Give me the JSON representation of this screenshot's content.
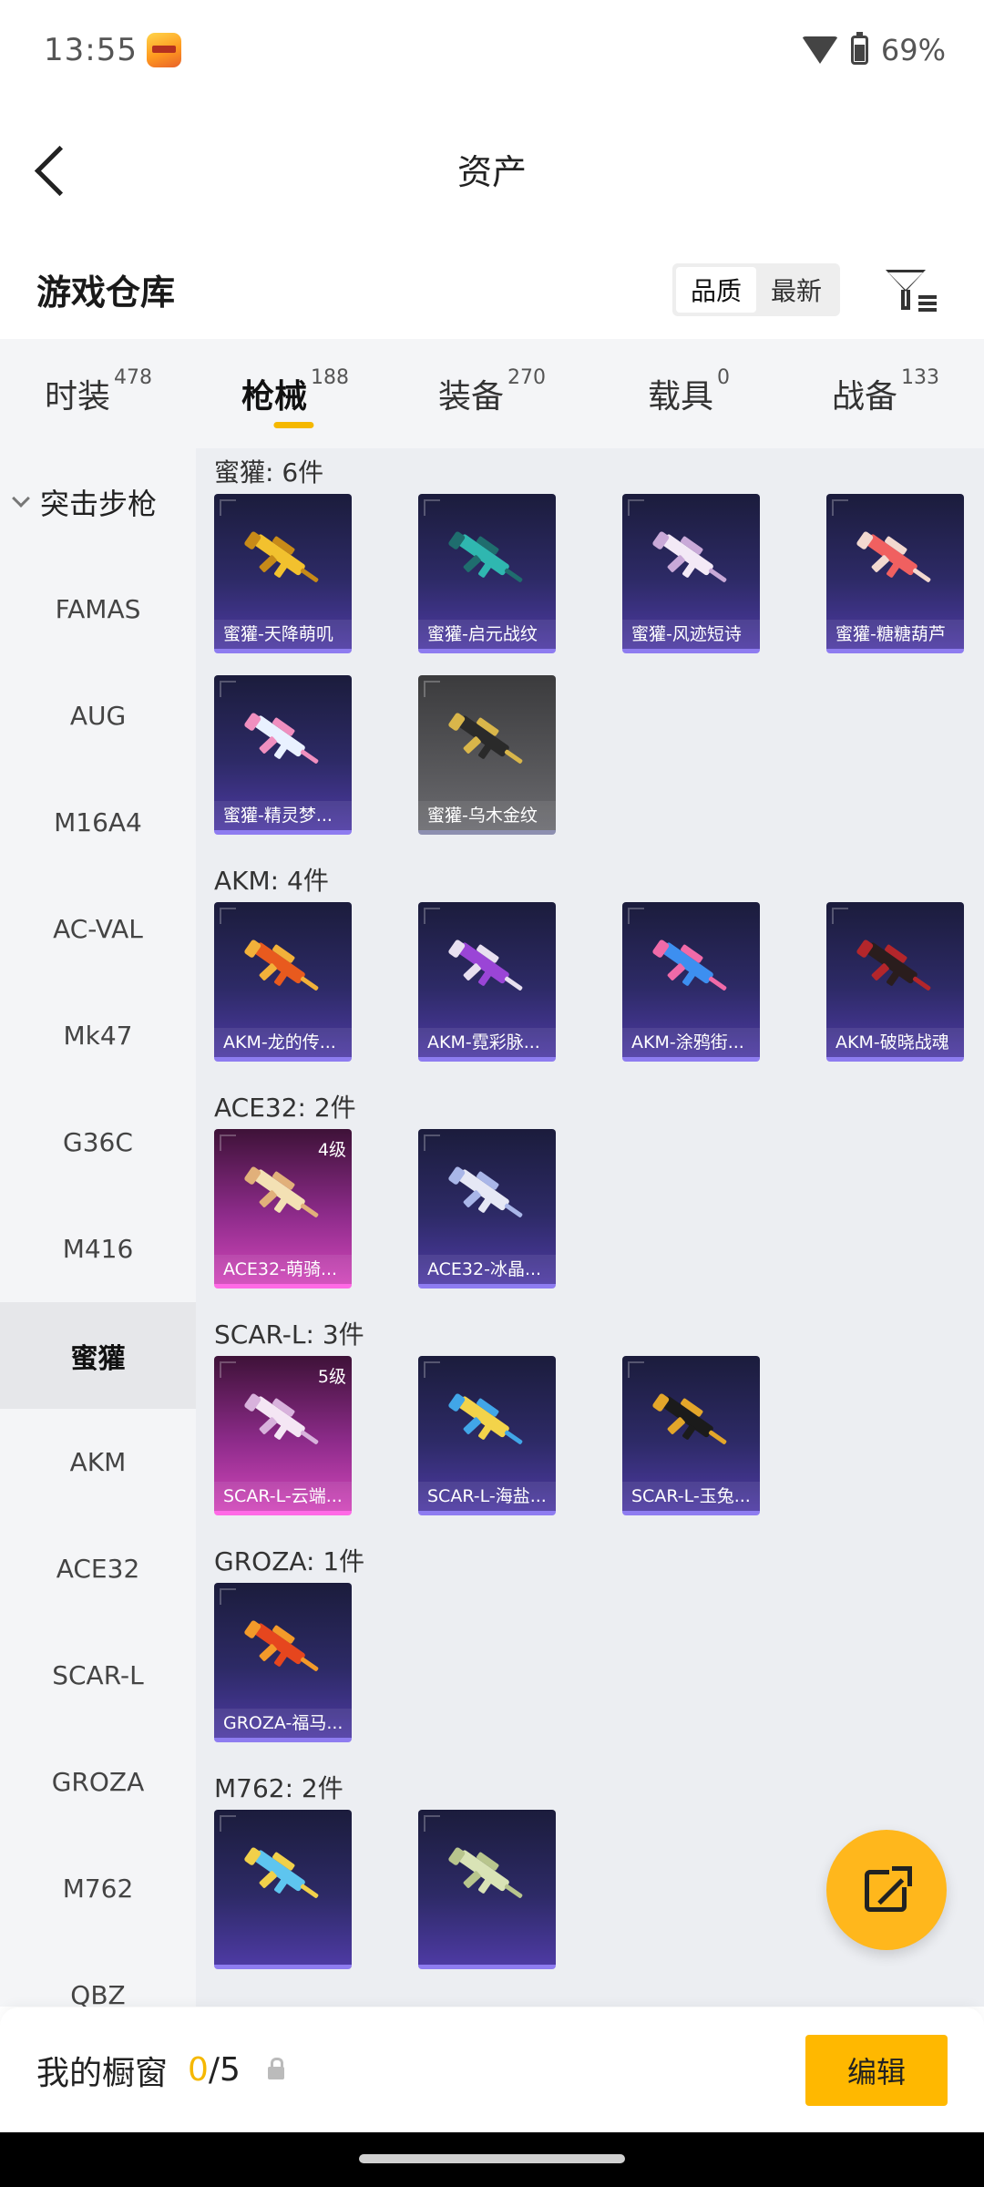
{
  "status": {
    "time": "13:55",
    "battery": "69%"
  },
  "header": {
    "title": "资产"
  },
  "warehouse": {
    "title": "游戏仓库",
    "sort": [
      "品质",
      "最新"
    ],
    "sort_active": 0
  },
  "categories": [
    {
      "label": "时装",
      "count": "478"
    },
    {
      "label": "枪械",
      "count": "188",
      "active": true
    },
    {
      "label": "装备",
      "count": "270"
    },
    {
      "label": "载具",
      "count": "0"
    },
    {
      "label": "战备",
      "count": "133"
    }
  ],
  "sidebar": {
    "head": "突击步枪",
    "items": [
      "FAMAS",
      "AUG",
      "M16A4",
      "AC-VAL",
      "Mk47",
      "G36C",
      "M416",
      "蜜獾",
      "AKM",
      "ACE32",
      "SCAR-L",
      "GROZA",
      "M762",
      "QBZ"
    ],
    "active_index": 7
  },
  "groups": [
    {
      "title": "蜜獾: 6件",
      "items": [
        {
          "name": "蜜獾-天降萌叽",
          "quality": "purple",
          "colors": [
            "#f2c12e",
            "#c78a18"
          ]
        },
        {
          "name": "蜜獾-启元战纹",
          "quality": "purple",
          "colors": [
            "#2fb7b0",
            "#1f6d6e"
          ]
        },
        {
          "name": "蜜獾-风迹短诗",
          "quality": "purple",
          "colors": [
            "#f3e9f6",
            "#c9a9d8"
          ]
        },
        {
          "name": "蜜獾-糖糖葫芦",
          "quality": "purple",
          "colors": [
            "#f06060",
            "#f2d9d0"
          ]
        },
        {
          "name": "蜜獾-精灵梦...",
          "quality": "purple",
          "colors": [
            "#e9f1ff",
            "#f08fbf"
          ]
        },
        {
          "name": "蜜獾-乌木金纹",
          "quality": "gray",
          "colors": [
            "#2a2a2a",
            "#d9b64a"
          ]
        }
      ]
    },
    {
      "title": "AKM: 4件",
      "items": [
        {
          "name": "AKM-龙的传...",
          "quality": "purple",
          "colors": [
            "#e85a1e",
            "#f2b13a"
          ]
        },
        {
          "name": "AKM-霓彩脉...",
          "quality": "purple",
          "colors": [
            "#9a45d6",
            "#e8e0f0"
          ]
        },
        {
          "name": "AKM-涂鸦街...",
          "quality": "purple",
          "colors": [
            "#3d8ff0",
            "#f06aa8"
          ]
        },
        {
          "name": "AKM-破晓战魂",
          "quality": "purple",
          "colors": [
            "#2a1d1d",
            "#b3262b"
          ]
        }
      ]
    },
    {
      "title": "ACE32: 2件",
      "items": [
        {
          "name": "ACE32-萌骑...",
          "quality": "pink",
          "tag": "4级",
          "colors": [
            "#f3e1b4",
            "#e1b07a"
          ]
        },
        {
          "name": "ACE32-冰晶...",
          "quality": "purple",
          "colors": [
            "#e6e8f5",
            "#a9b6e8"
          ]
        }
      ]
    },
    {
      "title": "SCAR-L: 3件",
      "items": [
        {
          "name": "SCAR-L-云端...",
          "quality": "pink",
          "tag": "5级",
          "colors": [
            "#f4e6f4",
            "#d8b2dc"
          ]
        },
        {
          "name": "SCAR-L-海盐...",
          "quality": "purple",
          "colors": [
            "#f3d34a",
            "#41a6e8"
          ]
        },
        {
          "name": "SCAR-L-玉兔...",
          "quality": "purple",
          "colors": [
            "#1b1b1b",
            "#e3a62a"
          ]
        }
      ]
    },
    {
      "title": "GROZA: 1件",
      "items": [
        {
          "name": "GROZA-福马...",
          "quality": "purple",
          "colors": [
            "#e6461e",
            "#f39a2a"
          ]
        }
      ]
    },
    {
      "title": "M762: 2件",
      "items": [
        {
          "name": "",
          "quality": "purple",
          "colors": [
            "#5ec5ef",
            "#f1d04a"
          ]
        },
        {
          "name": "",
          "quality": "purple",
          "colors": [
            "#d9e3b6",
            "#b8c58d"
          ]
        }
      ]
    }
  ],
  "bottom": {
    "label": "我的橱窗",
    "current": "0",
    "total": "/5",
    "edit": "编辑"
  },
  "accent": "#ffb800"
}
